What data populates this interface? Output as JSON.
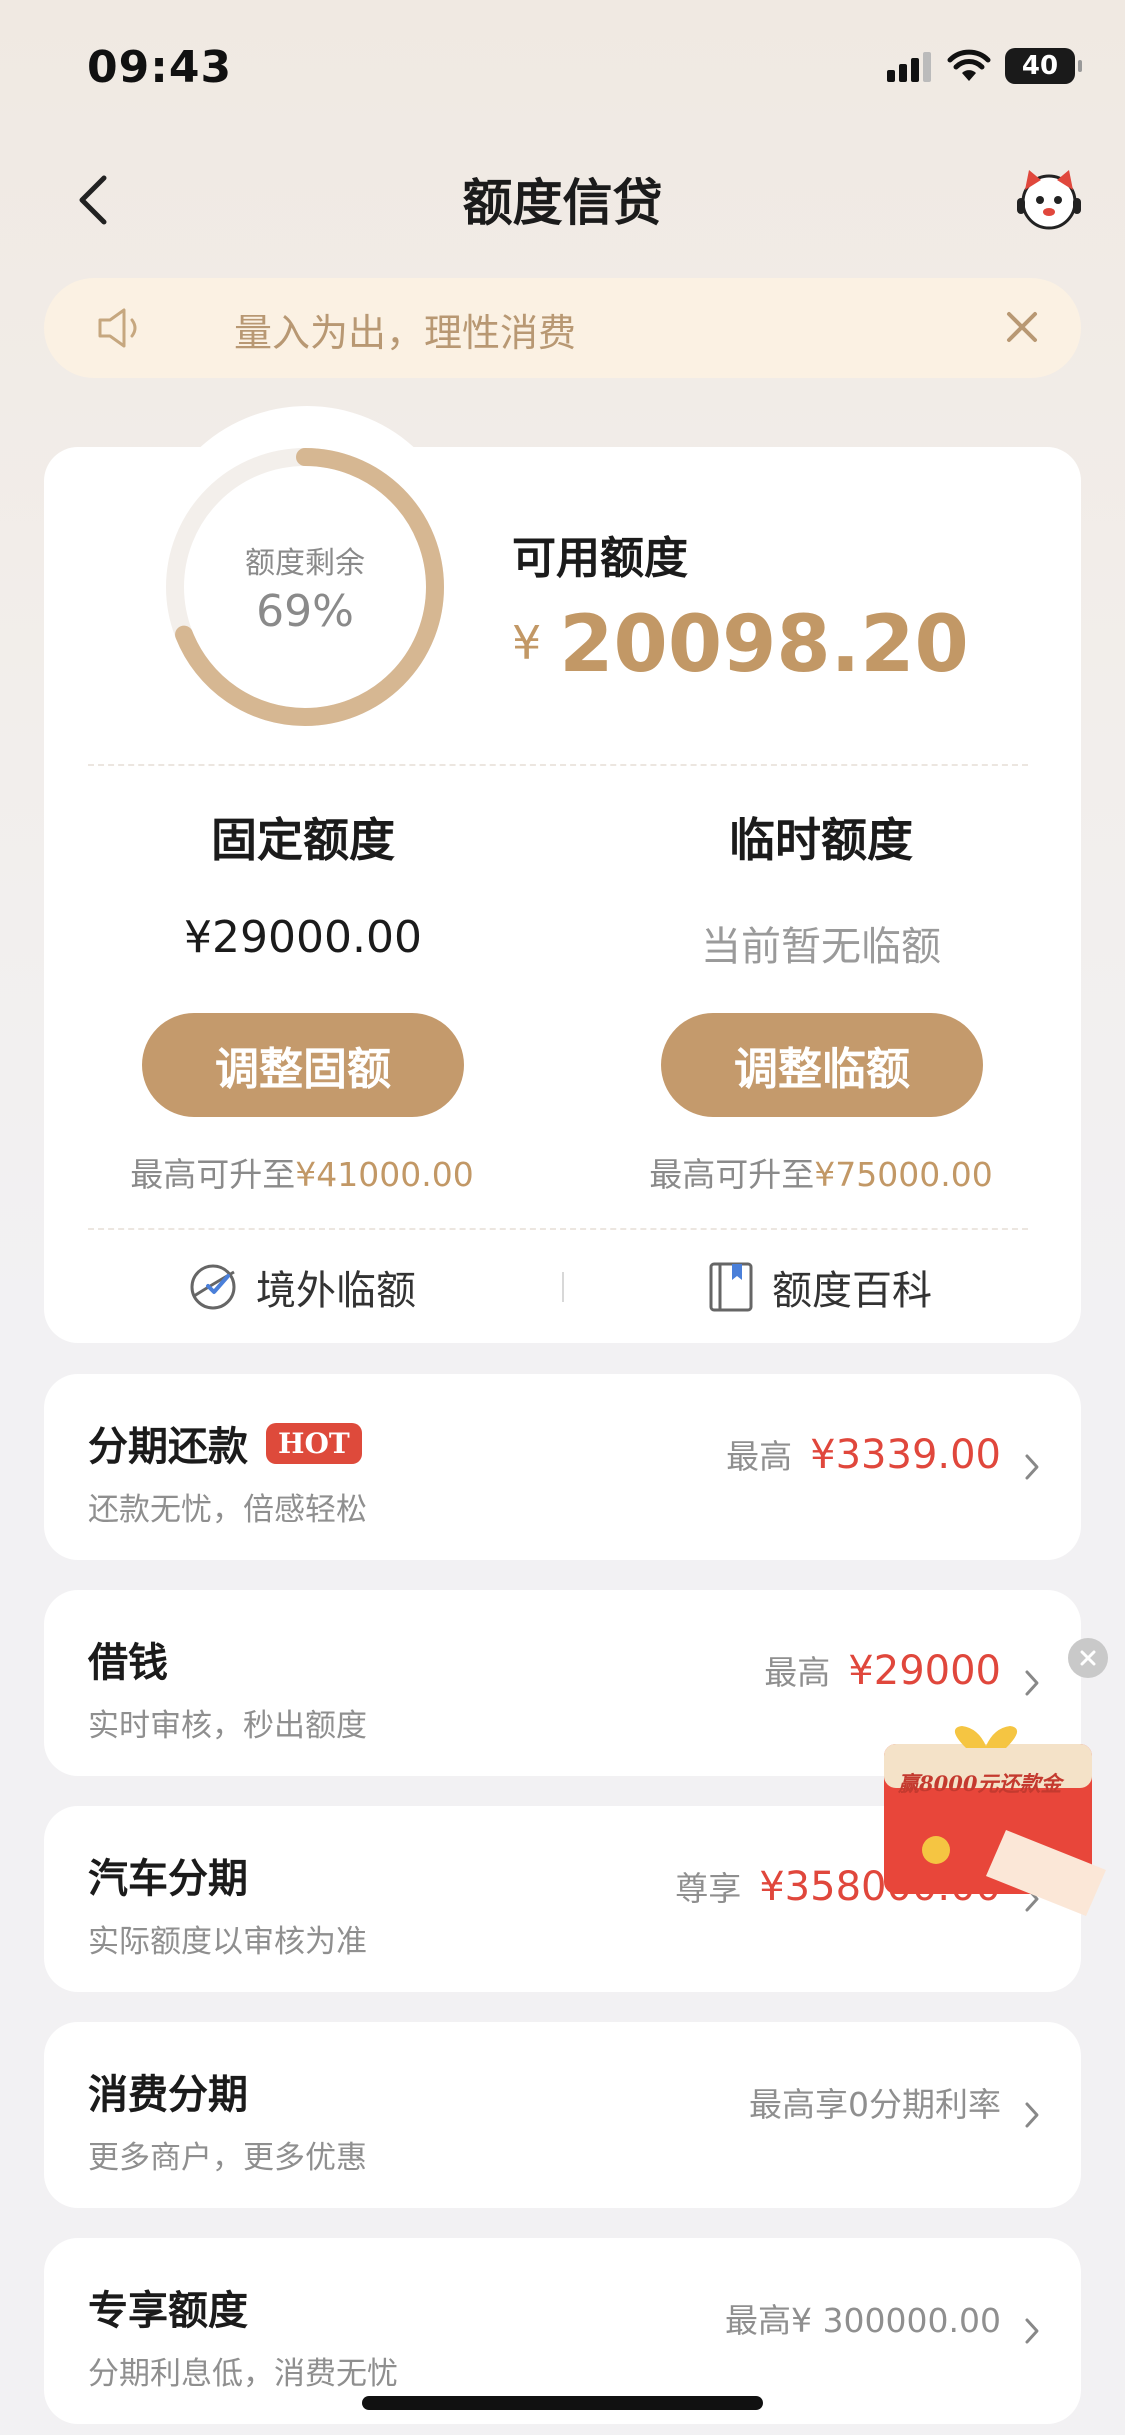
{
  "status": {
    "time": "09:43",
    "battery": "40"
  },
  "nav": {
    "title": "额度信贷"
  },
  "notice": {
    "text": "量入为出，理性消费"
  },
  "quota": {
    "gauge_label": "额度剩余",
    "gauge_percent": "69%",
    "gauge_fraction": 0.69,
    "available_label": "可用额度",
    "available_currency": "¥",
    "available_amount": "20098.20"
  },
  "fixed": {
    "title": "固定额度",
    "value": "¥29000.00",
    "button": "调整固额",
    "note_prefix": "最高可升至",
    "note_amount": "¥41000.00"
  },
  "temp": {
    "title": "临时额度",
    "value": "当前暂无临额",
    "button": "调整临额",
    "note_prefix": "最高可升至",
    "note_amount": "¥75000.00"
  },
  "quick_links": {
    "overseas": "境外临额",
    "wiki": "额度百科"
  },
  "rows": [
    {
      "title": "分期还款",
      "badge": "HOT",
      "subtitle": "还款无忧，倍感轻松",
      "prefix": "最高",
      "amount": "¥3339.00"
    },
    {
      "title": "借钱",
      "subtitle": "实时审核，秒出额度",
      "prefix": "最高",
      "amount": "¥29000"
    },
    {
      "title": "汽车分期",
      "subtitle": "实际额度以审核为准",
      "prefix": "尊享",
      "amount": "¥358000.00"
    },
    {
      "title": "消费分期",
      "subtitle": "更多商户，更多优惠",
      "text": "最高享0分期利率"
    },
    {
      "title": "专享额度",
      "subtitle": "分期利息低，消费无忧",
      "text": "最高¥ 300000.00"
    }
  ],
  "promo": {
    "text": "赢8000元还款金"
  },
  "colors": {
    "gold": "#c49a6c",
    "red": "#e0473c",
    "notice_bg": "#fbf1e3"
  }
}
